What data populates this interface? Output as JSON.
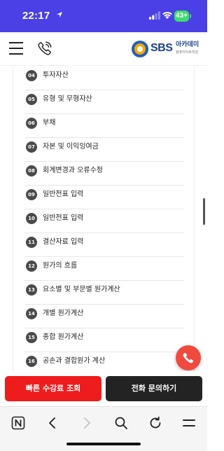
{
  "status_bar": {
    "time": "22:17",
    "battery": "43+",
    "background_color": "#4b3fe6"
  },
  "header": {
    "menu_icon": "hamburger-menu-icon",
    "phone_icon": "phone-icon",
    "logo_brand": "SBS",
    "logo_korean": "아카데미",
    "logo_subtitle": "컴퓨터아트학원"
  },
  "curriculum": {
    "items": [
      {
        "number": "04",
        "label": "투자자산"
      },
      {
        "number": "05",
        "label": "유형 및 무형자산"
      },
      {
        "number": "06",
        "label": "부채"
      },
      {
        "number": "07",
        "label": "자본 및 이익잉여금"
      },
      {
        "number": "08",
        "label": "회계변경과 오류수정"
      },
      {
        "number": "09",
        "label": "일반전표 입력"
      },
      {
        "number": "10",
        "label": "일반전표 입력"
      },
      {
        "number": "11",
        "label": "결산자료 입력"
      },
      {
        "number": "12",
        "label": "원가의 흐름"
      },
      {
        "number": "13",
        "label": "요소별 및 부문별 원가계산"
      },
      {
        "number": "14",
        "label": "개별 원가계산"
      },
      {
        "number": "15",
        "label": "종합 원가계산"
      },
      {
        "number": "16",
        "label": "공손과 결합원가 계산"
      }
    ]
  },
  "floating_button": {
    "icon": "phone-icon",
    "color": "#f04a3e"
  },
  "cta": {
    "left_label": "빠른 수강료 조회",
    "right_label": "전화 문의하기",
    "left_color": "#ee1c1c",
    "right_color": "#232323"
  },
  "browser_toolbar": {
    "icons": [
      "naver-home-icon",
      "back-arrow-icon",
      "forward-arrow-icon",
      "search-icon",
      "refresh-icon",
      "menu-icon"
    ]
  }
}
